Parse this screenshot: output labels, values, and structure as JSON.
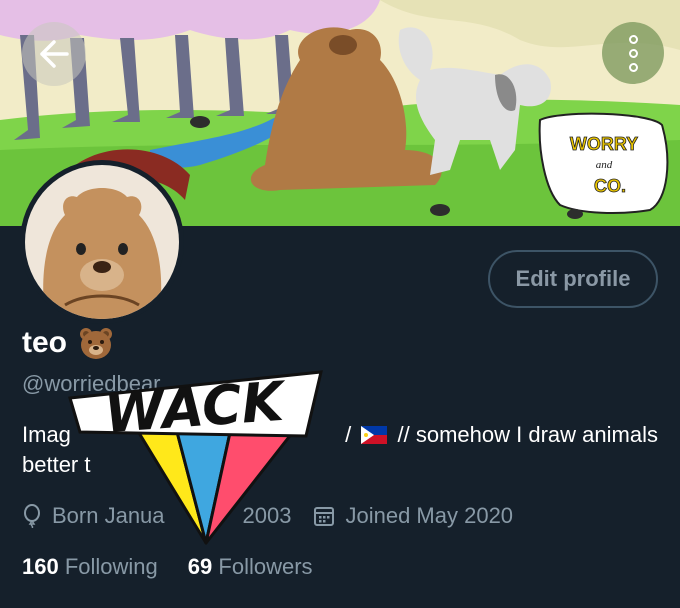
{
  "header": {
    "back_icon": "arrow-left-icon",
    "more_icon": "more-vertical-icon"
  },
  "banner": {
    "sign_line1": "WORRY",
    "sign_line2": "and",
    "sign_line3": "CO."
  },
  "profile": {
    "edit_label": "Edit profile",
    "display_name": "teo",
    "name_emoji": "bear-face-icon",
    "handle": "@worriedbear",
    "bio_start": "Imag",
    "bio_after_flag": " // somehow I draw animals",
    "bio_line2": "better t",
    "bio_slash": "/",
    "flag_icon": "philippines-flag-icon"
  },
  "meta": {
    "birthday": "Born Janua",
    "birthday_tail": "2003",
    "joined": "Joined May 2020"
  },
  "stats": {
    "following_count": "160",
    "following_label": "Following",
    "followers_count": "69",
    "followers_label": "Followers"
  },
  "sticker": {
    "text": "WACK",
    "colors": [
      "#ffe81a",
      "#3fa7e0",
      "#ff4d6d"
    ]
  },
  "colors": {
    "background": "#15202b",
    "muted": "#8899a6",
    "border": "#3d5466"
  }
}
